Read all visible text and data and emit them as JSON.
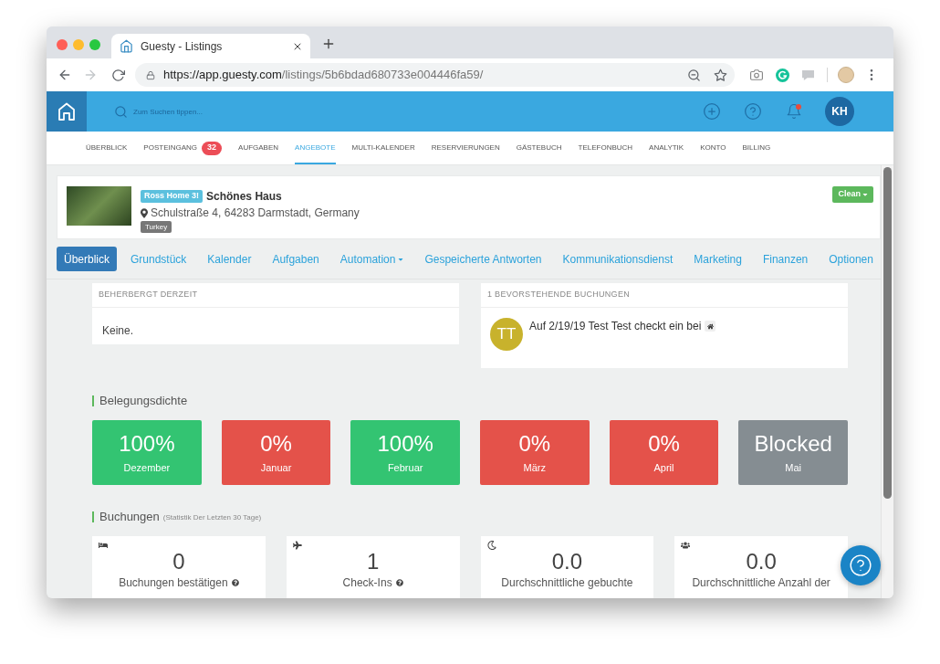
{
  "browser": {
    "tab_title": "Guesty - Listings",
    "url_host": "https://app.guesty.com",
    "url_path": "/listings/5b6bdad680733e004446fa59/",
    "forward_disabled": true
  },
  "header": {
    "search_placeholder": "Zum Suchen tippen...",
    "notifications_unread": true,
    "user_initials": "KH"
  },
  "nav": [
    {
      "label": "ÜBERBLICK",
      "selected": false
    },
    {
      "label": "POSTEINGANG",
      "selected": false,
      "badge": "32"
    },
    {
      "label": "AUFGABEN",
      "selected": false
    },
    {
      "label": "ANGEBOTE",
      "selected": true
    },
    {
      "label": "MULTI-KALENDER",
      "selected": false
    },
    {
      "label": "RESERVIERUNGEN",
      "selected": false
    },
    {
      "label": "GÄSTEBUCH",
      "selected": false
    },
    {
      "label": "TELEFONBUCH",
      "selected": false
    },
    {
      "label": "ANALYTIK",
      "selected": false
    },
    {
      "label": "KONTO",
      "selected": false
    },
    {
      "label": "BILLING",
      "selected": false
    }
  ],
  "listing": {
    "nickname": "Ross Home 3!",
    "title": "Schönes Haus",
    "address": "Schulstraße 4, 64283 Darmstadt, Germany",
    "tag": "Turkey",
    "status_button": "Clean"
  },
  "tabs": [
    {
      "label": "Überblick",
      "selected": true,
      "dropdown": false
    },
    {
      "label": "Grundstück",
      "selected": false,
      "dropdown": false
    },
    {
      "label": "Kalender",
      "selected": false,
      "dropdown": false
    },
    {
      "label": "Aufgaben",
      "selected": false,
      "dropdown": false
    },
    {
      "label": "Automation",
      "selected": false,
      "dropdown": true
    },
    {
      "label": "Gespeicherte Antworten",
      "selected": false,
      "dropdown": false
    },
    {
      "label": "Kommunikationsdienst",
      "selected": false,
      "dropdown": false
    },
    {
      "label": "Marketing",
      "selected": false,
      "dropdown": false
    },
    {
      "label": "Finanzen",
      "selected": false,
      "dropdown": false
    },
    {
      "label": "Optionen",
      "selected": false,
      "dropdown": false
    }
  ],
  "hosting_now": {
    "title": "BEHERBERGT DERZEIT",
    "text": "Keine."
  },
  "upcoming": {
    "title": "1 BEVORSTEHENDE BUCHUNGEN",
    "bookings": [
      {
        "initials": "TT",
        "text": "Auf 2/19/19 Test Test checkt ein bei"
      }
    ]
  },
  "occupancy": {
    "title": "Belegungsdichte",
    "months": [
      {
        "value": "100%",
        "label": "Dezember",
        "color": "#33c472"
      },
      {
        "value": "0%",
        "label": "Januar",
        "color": "#e4524a"
      },
      {
        "value": "100%",
        "label": "Februar",
        "color": "#33c472"
      },
      {
        "value": "0%",
        "label": "März",
        "color": "#e4524a"
      },
      {
        "value": "0%",
        "label": "April",
        "color": "#e4524a"
      },
      {
        "value": "Blocked",
        "label": "Mai",
        "color": "#858d92"
      }
    ]
  },
  "bookings": {
    "title": "Buchungen",
    "subtitle": "(Statistik Der Letzten 30 Tage)",
    "stats": [
      {
        "kind": "bed",
        "value": "0",
        "label": "Buchungen bestätigen",
        "help": true
      },
      {
        "kind": "plane",
        "value": "1",
        "label": "Check-Ins",
        "help": true
      },
      {
        "kind": "moon",
        "value": "0.0",
        "label": "Durchschnittliche gebuchte",
        "help": false
      },
      {
        "kind": "users",
        "value": "0.0",
        "label": "Durchschnittliche Anzahl der",
        "help": false
      }
    ]
  }
}
